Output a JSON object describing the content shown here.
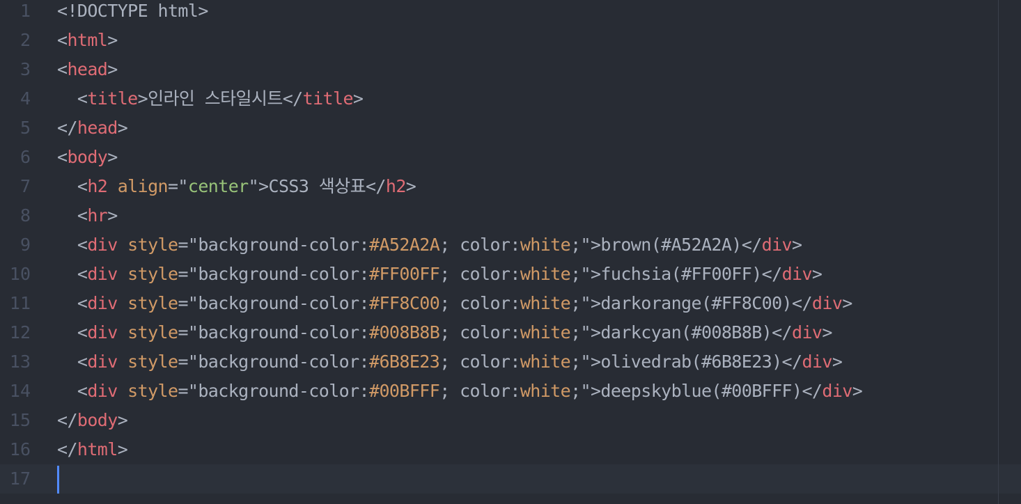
{
  "colors": {
    "background": "#282c34",
    "active_line": "#2c313a",
    "gutter_text": "#495162",
    "plain": "#abb2bf",
    "tag": "#e06c75",
    "attribute": "#d19a66",
    "string": "#98c379",
    "number": "#d19a66",
    "cursor": "#528bff"
  },
  "editor": {
    "cursor_line": 17,
    "lines": [
      {
        "n": "1",
        "tokens": [
          {
            "t": "<!DOCTYPE html>",
            "c": "plain"
          }
        ]
      },
      {
        "n": "2",
        "tokens": [
          {
            "t": "<",
            "c": "plain"
          },
          {
            "t": "html",
            "c": "tag"
          },
          {
            "t": ">",
            "c": "plain"
          }
        ]
      },
      {
        "n": "3",
        "tokens": [
          {
            "t": "<",
            "c": "plain"
          },
          {
            "t": "head",
            "c": "tag"
          },
          {
            "t": ">",
            "c": "plain"
          }
        ]
      },
      {
        "n": "4",
        "tokens": [
          {
            "t": "  <",
            "c": "plain"
          },
          {
            "t": "title",
            "c": "tag"
          },
          {
            "t": ">인라인 스타일시트</",
            "c": "plain"
          },
          {
            "t": "title",
            "c": "tag"
          },
          {
            "t": ">",
            "c": "plain"
          }
        ]
      },
      {
        "n": "5",
        "tokens": [
          {
            "t": "</",
            "c": "plain"
          },
          {
            "t": "head",
            "c": "tag"
          },
          {
            "t": ">",
            "c": "plain"
          }
        ]
      },
      {
        "n": "6",
        "tokens": [
          {
            "t": "<",
            "c": "plain"
          },
          {
            "t": "body",
            "c": "tag"
          },
          {
            "t": ">",
            "c": "plain"
          }
        ]
      },
      {
        "n": "7",
        "tokens": [
          {
            "t": "  <",
            "c": "plain"
          },
          {
            "t": "h2",
            "c": "tag"
          },
          {
            "t": " ",
            "c": "plain"
          },
          {
            "t": "align",
            "c": "attr"
          },
          {
            "t": "=\"",
            "c": "plain"
          },
          {
            "t": "center",
            "c": "str"
          },
          {
            "t": "\">CSS3 색상표</",
            "c": "plain"
          },
          {
            "t": "h2",
            "c": "tag"
          },
          {
            "t": ">",
            "c": "plain"
          }
        ]
      },
      {
        "n": "8",
        "tokens": [
          {
            "t": "  <",
            "c": "plain"
          },
          {
            "t": "hr",
            "c": "tag"
          },
          {
            "t": ">",
            "c": "plain"
          }
        ]
      },
      {
        "n": "9",
        "tokens": [
          {
            "t": "  <",
            "c": "plain"
          },
          {
            "t": "div",
            "c": "tag"
          },
          {
            "t": " ",
            "c": "plain"
          },
          {
            "t": "style",
            "c": "attr"
          },
          {
            "t": "=\"background-color:",
            "c": "plain"
          },
          {
            "t": "#A52A2A",
            "c": "num"
          },
          {
            "t": "; color:",
            "c": "plain"
          },
          {
            "t": "white",
            "c": "num"
          },
          {
            "t": ";\">brown(#A52A2A)</",
            "c": "plain"
          },
          {
            "t": "div",
            "c": "tag"
          },
          {
            "t": ">",
            "c": "plain"
          }
        ]
      },
      {
        "n": "10",
        "tokens": [
          {
            "t": "  <",
            "c": "plain"
          },
          {
            "t": "div",
            "c": "tag"
          },
          {
            "t": " ",
            "c": "plain"
          },
          {
            "t": "style",
            "c": "attr"
          },
          {
            "t": "=\"background-color:",
            "c": "plain"
          },
          {
            "t": "#FF00FF",
            "c": "num"
          },
          {
            "t": "; color:",
            "c": "plain"
          },
          {
            "t": "white",
            "c": "num"
          },
          {
            "t": ";\">fuchsia(#FF00FF)</",
            "c": "plain"
          },
          {
            "t": "div",
            "c": "tag"
          },
          {
            "t": ">",
            "c": "plain"
          }
        ]
      },
      {
        "n": "11",
        "tokens": [
          {
            "t": "  <",
            "c": "plain"
          },
          {
            "t": "div",
            "c": "tag"
          },
          {
            "t": " ",
            "c": "plain"
          },
          {
            "t": "style",
            "c": "attr"
          },
          {
            "t": "=\"background-color:",
            "c": "plain"
          },
          {
            "t": "#FF8C00",
            "c": "num"
          },
          {
            "t": "; color:",
            "c": "plain"
          },
          {
            "t": "white",
            "c": "num"
          },
          {
            "t": ";\">darkorange(#FF8C00)</",
            "c": "plain"
          },
          {
            "t": "div",
            "c": "tag"
          },
          {
            "t": ">",
            "c": "plain"
          }
        ]
      },
      {
        "n": "12",
        "tokens": [
          {
            "t": "  <",
            "c": "plain"
          },
          {
            "t": "div",
            "c": "tag"
          },
          {
            "t": " ",
            "c": "plain"
          },
          {
            "t": "style",
            "c": "attr"
          },
          {
            "t": "=\"background-color:",
            "c": "plain"
          },
          {
            "t": "#008B8B",
            "c": "num"
          },
          {
            "t": "; color:",
            "c": "plain"
          },
          {
            "t": "white",
            "c": "num"
          },
          {
            "t": ";\">darkcyan(#008B8B)</",
            "c": "plain"
          },
          {
            "t": "div",
            "c": "tag"
          },
          {
            "t": ">",
            "c": "plain"
          }
        ]
      },
      {
        "n": "13",
        "tokens": [
          {
            "t": "  <",
            "c": "plain"
          },
          {
            "t": "div",
            "c": "tag"
          },
          {
            "t": " ",
            "c": "plain"
          },
          {
            "t": "style",
            "c": "attr"
          },
          {
            "t": "=\"background-color:",
            "c": "plain"
          },
          {
            "t": "#6B8E23",
            "c": "num"
          },
          {
            "t": "; color:",
            "c": "plain"
          },
          {
            "t": "white",
            "c": "num"
          },
          {
            "t": ";\">olivedrab(#6B8E23)</",
            "c": "plain"
          },
          {
            "t": "div",
            "c": "tag"
          },
          {
            "t": ">",
            "c": "plain"
          }
        ]
      },
      {
        "n": "14",
        "tokens": [
          {
            "t": "  <",
            "c": "plain"
          },
          {
            "t": "div",
            "c": "tag"
          },
          {
            "t": " ",
            "c": "plain"
          },
          {
            "t": "style",
            "c": "attr"
          },
          {
            "t": "=\"background-color:",
            "c": "plain"
          },
          {
            "t": "#00BFFF",
            "c": "num"
          },
          {
            "t": "; color:",
            "c": "plain"
          },
          {
            "t": "white",
            "c": "num"
          },
          {
            "t": ";\">deepskyblue(#00BFFF)</",
            "c": "plain"
          },
          {
            "t": "div",
            "c": "tag"
          },
          {
            "t": ">",
            "c": "plain"
          }
        ]
      },
      {
        "n": "15",
        "tokens": [
          {
            "t": "</",
            "c": "plain"
          },
          {
            "t": "body",
            "c": "tag"
          },
          {
            "t": ">",
            "c": "plain"
          }
        ]
      },
      {
        "n": "16",
        "tokens": [
          {
            "t": "</",
            "c": "plain"
          },
          {
            "t": "html",
            "c": "tag"
          },
          {
            "t": ">",
            "c": "plain"
          }
        ]
      },
      {
        "n": "17",
        "tokens": []
      }
    ]
  }
}
